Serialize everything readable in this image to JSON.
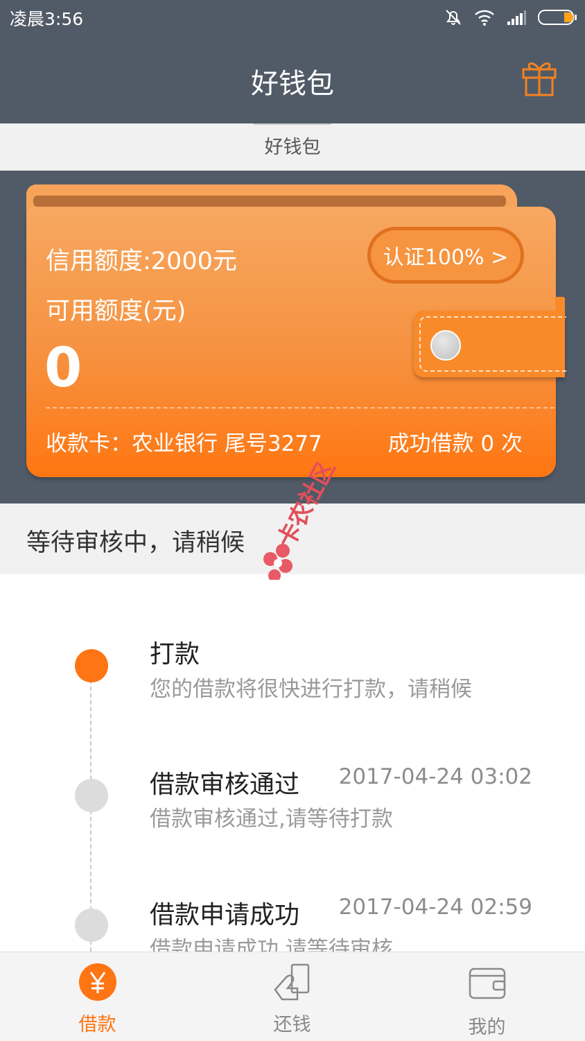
{
  "status_bar": {
    "time": "凌晨3:56"
  },
  "app_bar": {
    "title": "好钱包"
  },
  "sub_tab": {
    "label": "好钱包"
  },
  "card": {
    "credit_limit": "信用额度:2000元",
    "available_label": "可用额度(元)",
    "available_value": "0",
    "certify_button": "认证100% >",
    "bank_info": "收款卡：农业银行 尾号3277",
    "success_count": "成功借款 0 次"
  },
  "review_status": "等待审核中，请稍候",
  "watermark_text": "卡农社区",
  "timeline": [
    {
      "title": "打款",
      "desc": "您的借款将很快进行打款，请稍候",
      "time": ""
    },
    {
      "title": "借款审核通过",
      "desc": "借款审核通过,请等待打款",
      "time": "2017-04-24 03:02"
    },
    {
      "title": "借款申请成功",
      "desc": "借款申请成功,请等待审核",
      "time": "2017-04-24 02:59"
    }
  ],
  "bottom_nav": [
    {
      "label": "借款",
      "icon": "yuan-icon",
      "active": true
    },
    {
      "label": "还钱",
      "icon": "repay-icon",
      "active": false
    },
    {
      "label": "我的",
      "icon": "wallet-icon",
      "active": false
    }
  ],
  "colors": {
    "accent": "#ff7413",
    "header": "#515b67",
    "card": "#f6913f"
  }
}
